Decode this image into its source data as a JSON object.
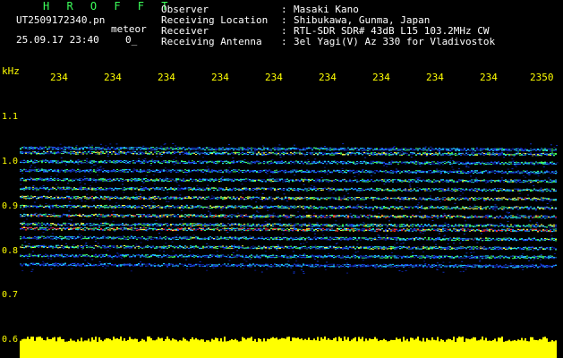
{
  "header": {
    "title": "H R O F F T",
    "filename": "UT2509172340.pn",
    "meteor_label": "meteor",
    "datetime": "25.09.17 23:40",
    "count": "0_"
  },
  "info": {
    "observer_label": "Observer",
    "observer_value": "Masaki Kano",
    "location_label": "Receiving Location",
    "location_value": "Shibukawa, Gunma, Japan",
    "receiver_label": "Receiver",
    "receiver_value": "RTL-SDR SDR# 43dB L15 103.2MHz CW",
    "antenna_label": "Receiving Antenna",
    "antenna_value": "3el Yagi(V) Az 330 for Vladivostok",
    "separator": ":"
  },
  "axis": {
    "unit": "kHz",
    "time_ticks": [
      "234",
      "234",
      "234",
      "234",
      "234",
      "234",
      "234",
      "234",
      "234",
      "2350"
    ],
    "freq_ticks": [
      "1.1",
      "1.0",
      "0.9",
      "0.8",
      "0.7",
      "0.6"
    ]
  },
  "colors": {
    "label": "#ffff00",
    "title": "#3cff5a",
    "noise_bar": "#ffff00",
    "background": "#000000"
  },
  "chart_data": {
    "type": "heatmap",
    "title": "",
    "xlabel": "",
    "ylabel": "kHz",
    "ylim": [
      0.6,
      1.15
    ],
    "bands": [
      {
        "freq": 1.03,
        "intensity": 0.55
      },
      {
        "freq": 1.02,
        "intensity": 0.75
      },
      {
        "freq": 1.0,
        "intensity": 0.6
      },
      {
        "freq": 0.98,
        "intensity": 0.55
      },
      {
        "freq": 0.96,
        "intensity": 0.65
      },
      {
        "freq": 0.94,
        "intensity": 0.7
      },
      {
        "freq": 0.92,
        "intensity": 0.8
      },
      {
        "freq": 0.9,
        "intensity": 0.75
      },
      {
        "freq": 0.88,
        "intensity": 0.85
      },
      {
        "freq": 0.86,
        "intensity": 0.7
      },
      {
        "freq": 0.85,
        "intensity": 1.0
      },
      {
        "freq": 0.83,
        "intensity": 0.65
      },
      {
        "freq": 0.81,
        "intensity": 0.7
      },
      {
        "freq": 0.79,
        "intensity": 0.6
      },
      {
        "freq": 0.77,
        "intensity": 0.45
      }
    ]
  }
}
